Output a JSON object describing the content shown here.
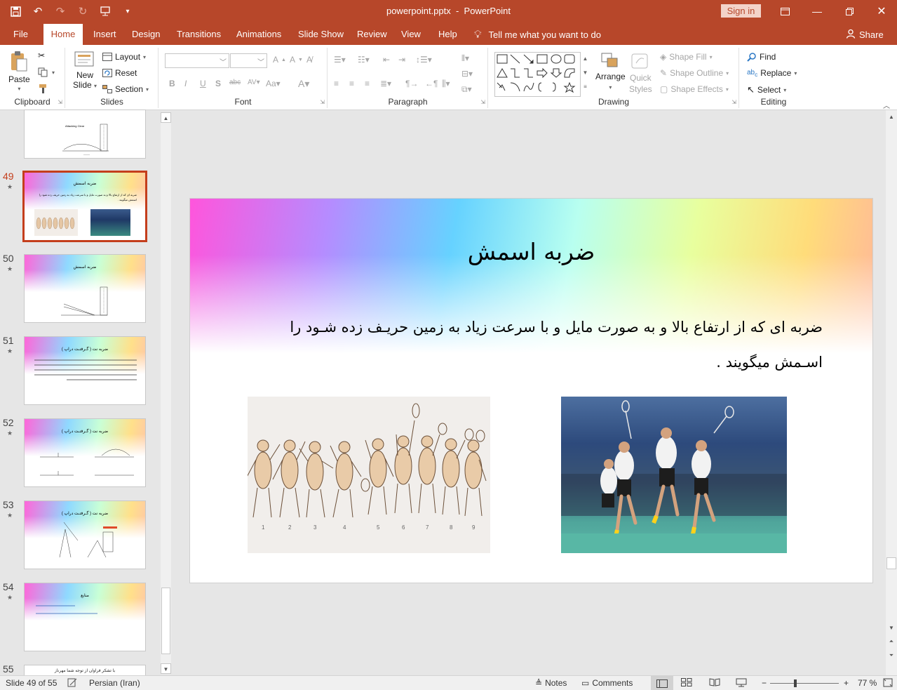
{
  "app": {
    "file_name": "powerpoint.pptx",
    "app_name": "PowerPoint",
    "title_sep": "  -  ",
    "sign_in": "Sign in"
  },
  "tabs": [
    "File",
    "Home",
    "Insert",
    "Design",
    "Transitions",
    "Animations",
    "Slide Show",
    "Review",
    "View",
    "Help"
  ],
  "active_tab": "Home",
  "tell_me": "Tell me what you want to do",
  "share": "Share",
  "ribbon": {
    "clipboard": {
      "label": "Clipboard",
      "paste": "Paste"
    },
    "slides": {
      "label": "Slides",
      "new_slide_1": "New",
      "new_slide_2": "Slide",
      "layout": "Layout",
      "reset": "Reset",
      "section": "Section"
    },
    "font": {
      "label": "Font"
    },
    "paragraph": {
      "label": "Paragraph"
    },
    "drawing": {
      "label": "Drawing",
      "arrange": "Arrange",
      "quick_styles_1": "Quick",
      "quick_styles_2": "Styles",
      "shape_fill": "Shape Fill",
      "shape_outline": "Shape Outline",
      "shape_effects": "Shape Effects"
    },
    "editing": {
      "label": "Editing",
      "find": "Find",
      "replace": "Replace",
      "select": "Select"
    }
  },
  "thumbnails": [
    {
      "num": "",
      "title": "",
      "body": ""
    },
    {
      "num": "49",
      "title": "ضربه اسمش",
      "body": "ضربه ای که از ارتفاع بالا و به صورت مایل و با سرعت زیاد به زمین حریف زده شود را اسمش میگویند ."
    },
    {
      "num": "50",
      "title": "ضربه اسمش",
      "body": ""
    },
    {
      "num": "51",
      "title": "ضربه نت ( گـرفتـت دراپ )",
      "body": ""
    },
    {
      "num": "52",
      "title": "ضربه نت ( گـرفتـت دراپ )",
      "body": ""
    },
    {
      "num": "53",
      "title": "ضربه نت ( گـرفتـت دراپ )",
      "body": ""
    },
    {
      "num": "54",
      "title": "منابع",
      "body": ""
    },
    {
      "num": "55",
      "title": "با تشکر فراوان از توجه شما مهرناز",
      "body": ""
    }
  ],
  "slide": {
    "title": "ضربه اسمش",
    "body": "ضربه ای که از ارتفاع بالا و به صورت مایل و با سرعت زیاد به زمین حریـف زده شـود را اسـمش میگویند .",
    "figure_numbers": [
      "1",
      "2",
      "3",
      "4",
      "5",
      "6",
      "7",
      "8",
      "9"
    ]
  },
  "status": {
    "slide_info": "Slide 49 of 55",
    "language": "Persian (Iran)",
    "notes": "Notes",
    "comments": "Comments",
    "zoom": "77 %",
    "zoom_value": 77
  },
  "colors": {
    "accent": "#b7472a",
    "selected_thumb": "#c43e1c"
  }
}
